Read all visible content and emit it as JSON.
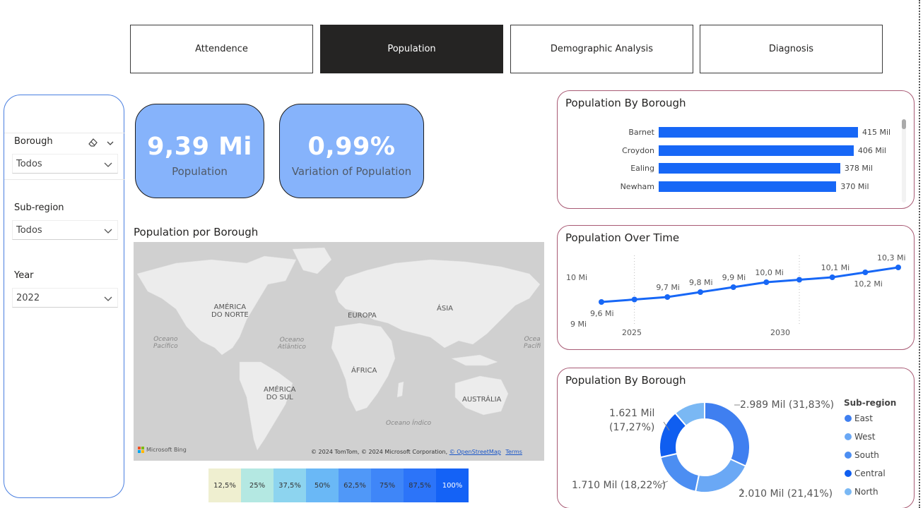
{
  "nav": {
    "tabs": [
      {
        "label": "Attendence"
      },
      {
        "label": "Population"
      },
      {
        "label": "Demographic Analysis"
      },
      {
        "label": "Diagnosis"
      }
    ],
    "active_index": 1
  },
  "filters": {
    "borough": {
      "label": "Borough",
      "value": "Todos"
    },
    "subregion": {
      "label": "Sub-region",
      "value": "Todos"
    },
    "year": {
      "label": "Year",
      "value": "2022"
    }
  },
  "kpis": {
    "population": {
      "value": "9,39 Mi",
      "label": "Population"
    },
    "variation": {
      "value": "0,99%",
      "label": "Variation of Population"
    }
  },
  "map": {
    "title": "Population por Borough",
    "labels": {
      "north_america": "AMÉRICA\nDO NORTE",
      "europe": "EUROPA",
      "asia": "ÁSIA",
      "africa": "ÁFRICA",
      "south_america": "AMÉRICA\nDO SUL",
      "australia": "AUSTRÁLIA",
      "pacific_left": "Oceano\nPacífico",
      "pacific_right": "Ocea\nPacífi",
      "atlantic": "Oceano\nAtlântico",
      "indian": "Oceano Índico"
    },
    "attribution": "© 2024 TomTom, © 2024 Microsoft Corporation,",
    "osm_link": "© OpenStreetMap",
    "terms_link": "Terms",
    "brand": "Microsoft Bing"
  },
  "color_legend": [
    {
      "label": "12,5%",
      "color": "#efefd0"
    },
    {
      "label": "25%",
      "color": "#b4e8e2"
    },
    {
      "label": "37,5%",
      "color": "#8dd4ef"
    },
    {
      "label": "50%",
      "color": "#6ab8f6"
    },
    {
      "label": "62,5%",
      "color": "#5098f8"
    },
    {
      "label": "75%",
      "color": "#3f86f8"
    },
    {
      "label": "87,5%",
      "color": "#2c74f9"
    },
    {
      "label": "100%",
      "color": "#1462f6"
    }
  ],
  "bar_panel": {
    "title": "Population By Borough",
    "chart_data": {
      "type": "bar",
      "orientation": "horizontal",
      "categories": [
        "Barnet",
        "Croydon",
        "Ealing",
        "Newham"
      ],
      "values": [
        415,
        406,
        378,
        370
      ],
      "value_labels": [
        "415 Mil",
        "406 Mil",
        "378 Mil",
        "370 Mil"
      ],
      "color": "#1767f6"
    }
  },
  "line_panel": {
    "title": "Population Over Time",
    "chart_data": {
      "type": "line",
      "x": [
        2024,
        2025,
        2026,
        2027,
        2028,
        2029,
        2030,
        2031,
        2032,
        2033
      ],
      "values": [
        9.6,
        9.65,
        9.7,
        9.8,
        9.9,
        10.0,
        10.05,
        10.1,
        10.2,
        10.3
      ],
      "value_labels": [
        "9,6 Mi",
        "",
        "9,7 Mi",
        "9,8 Mi",
        "9,9 Mi",
        "10,0 Mi",
        "",
        "10,1 Mi",
        "10,2 Mi",
        "10,3 Mi"
      ],
      "y_ticks": [
        "9 Mi",
        "10 Mi"
      ],
      "x_ticks": [
        "2025",
        "2030"
      ],
      "color": "#1767f6"
    }
  },
  "donut_panel": {
    "title": "Population By Borough",
    "chart_data": {
      "type": "pie",
      "legend_title": "Sub-region",
      "slices": [
        {
          "name": "East",
          "value": 2.989,
          "label": "2.989 Mil (31,83%)",
          "color": "#3f7ff0"
        },
        {
          "name": "West",
          "value": 2.01,
          "label": "2.010 Mil (21,41%)",
          "color": "#6aa8f5"
        },
        {
          "name": "South",
          "value": 1.71,
          "label": "1.710 Mil (18,22%)",
          "color": "#4c8ef2"
        },
        {
          "name": "Central",
          "value": 1.621,
          "label": "1.621 Mil\n(17,27%)",
          "color": "#0f5ef0"
        },
        {
          "name": "North",
          "value": 1.06,
          "label": "",
          "color": "#7ab8f4"
        }
      ]
    }
  }
}
